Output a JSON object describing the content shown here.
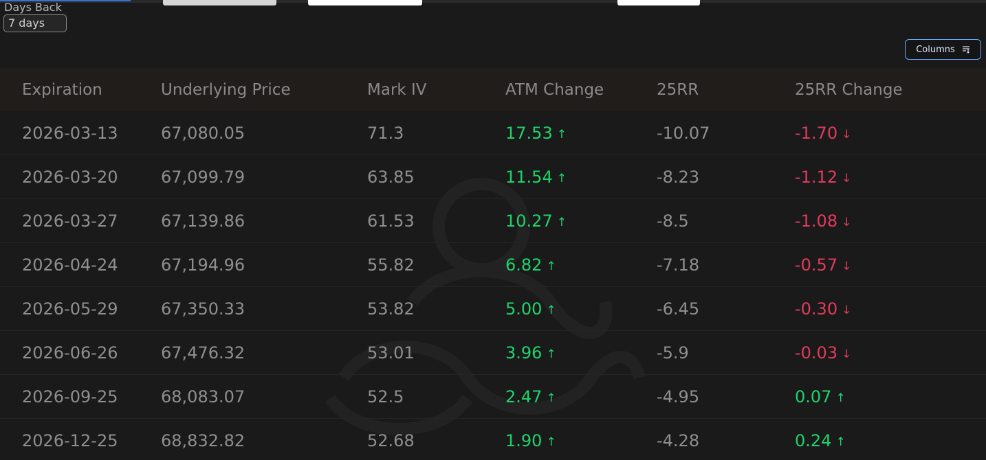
{
  "header": {
    "days_back_label": "Days Back",
    "days_back_value": "7 days",
    "columns_label": "Columns"
  },
  "colors": {
    "positive": "#1fd36a",
    "negative": "#e23a5c",
    "accent": "#6aa8ff"
  },
  "table": {
    "columns": [
      "Expiration",
      "Underlying Price",
      "Mark IV",
      "ATM Change",
      "25RR",
      "25RR Change"
    ],
    "rows": [
      {
        "expiration": "2026-03-13",
        "underlying": "67,080.05",
        "mark_iv": "71.3",
        "atm_change": "17.53",
        "atm_dir": "up",
        "rr25": "-10.07",
        "rr25_change": "-1.70",
        "rr25_dir": "down"
      },
      {
        "expiration": "2026-03-20",
        "underlying": "67,099.79",
        "mark_iv": "63.85",
        "atm_change": "11.54",
        "atm_dir": "up",
        "rr25": "-8.23",
        "rr25_change": "-1.12",
        "rr25_dir": "down"
      },
      {
        "expiration": "2026-03-27",
        "underlying": "67,139.86",
        "mark_iv": "61.53",
        "atm_change": "10.27",
        "atm_dir": "up",
        "rr25": "-8.5",
        "rr25_change": "-1.08",
        "rr25_dir": "down"
      },
      {
        "expiration": "2026-04-24",
        "underlying": "67,194.96",
        "mark_iv": "55.82",
        "atm_change": "6.82",
        "atm_dir": "up",
        "rr25": "-7.18",
        "rr25_change": "-0.57",
        "rr25_dir": "down"
      },
      {
        "expiration": "2026-05-29",
        "underlying": "67,350.33",
        "mark_iv": "53.82",
        "atm_change": "5.00",
        "atm_dir": "up",
        "rr25": "-6.45",
        "rr25_change": "-0.30",
        "rr25_dir": "down"
      },
      {
        "expiration": "2026-06-26",
        "underlying": "67,476.32",
        "mark_iv": "53.01",
        "atm_change": "3.96",
        "atm_dir": "up",
        "rr25": "-5.9",
        "rr25_change": "-0.03",
        "rr25_dir": "down"
      },
      {
        "expiration": "2026-09-25",
        "underlying": "68,083.07",
        "mark_iv": "52.5",
        "atm_change": "2.47",
        "atm_dir": "up",
        "rr25": "-4.95",
        "rr25_change": "0.07",
        "rr25_dir": "up"
      },
      {
        "expiration": "2026-12-25",
        "underlying": "68,832.82",
        "mark_iv": "52.68",
        "atm_change": "1.90",
        "atm_dir": "up",
        "rr25": "-4.28",
        "rr25_change": "0.24",
        "rr25_dir": "up"
      }
    ]
  }
}
